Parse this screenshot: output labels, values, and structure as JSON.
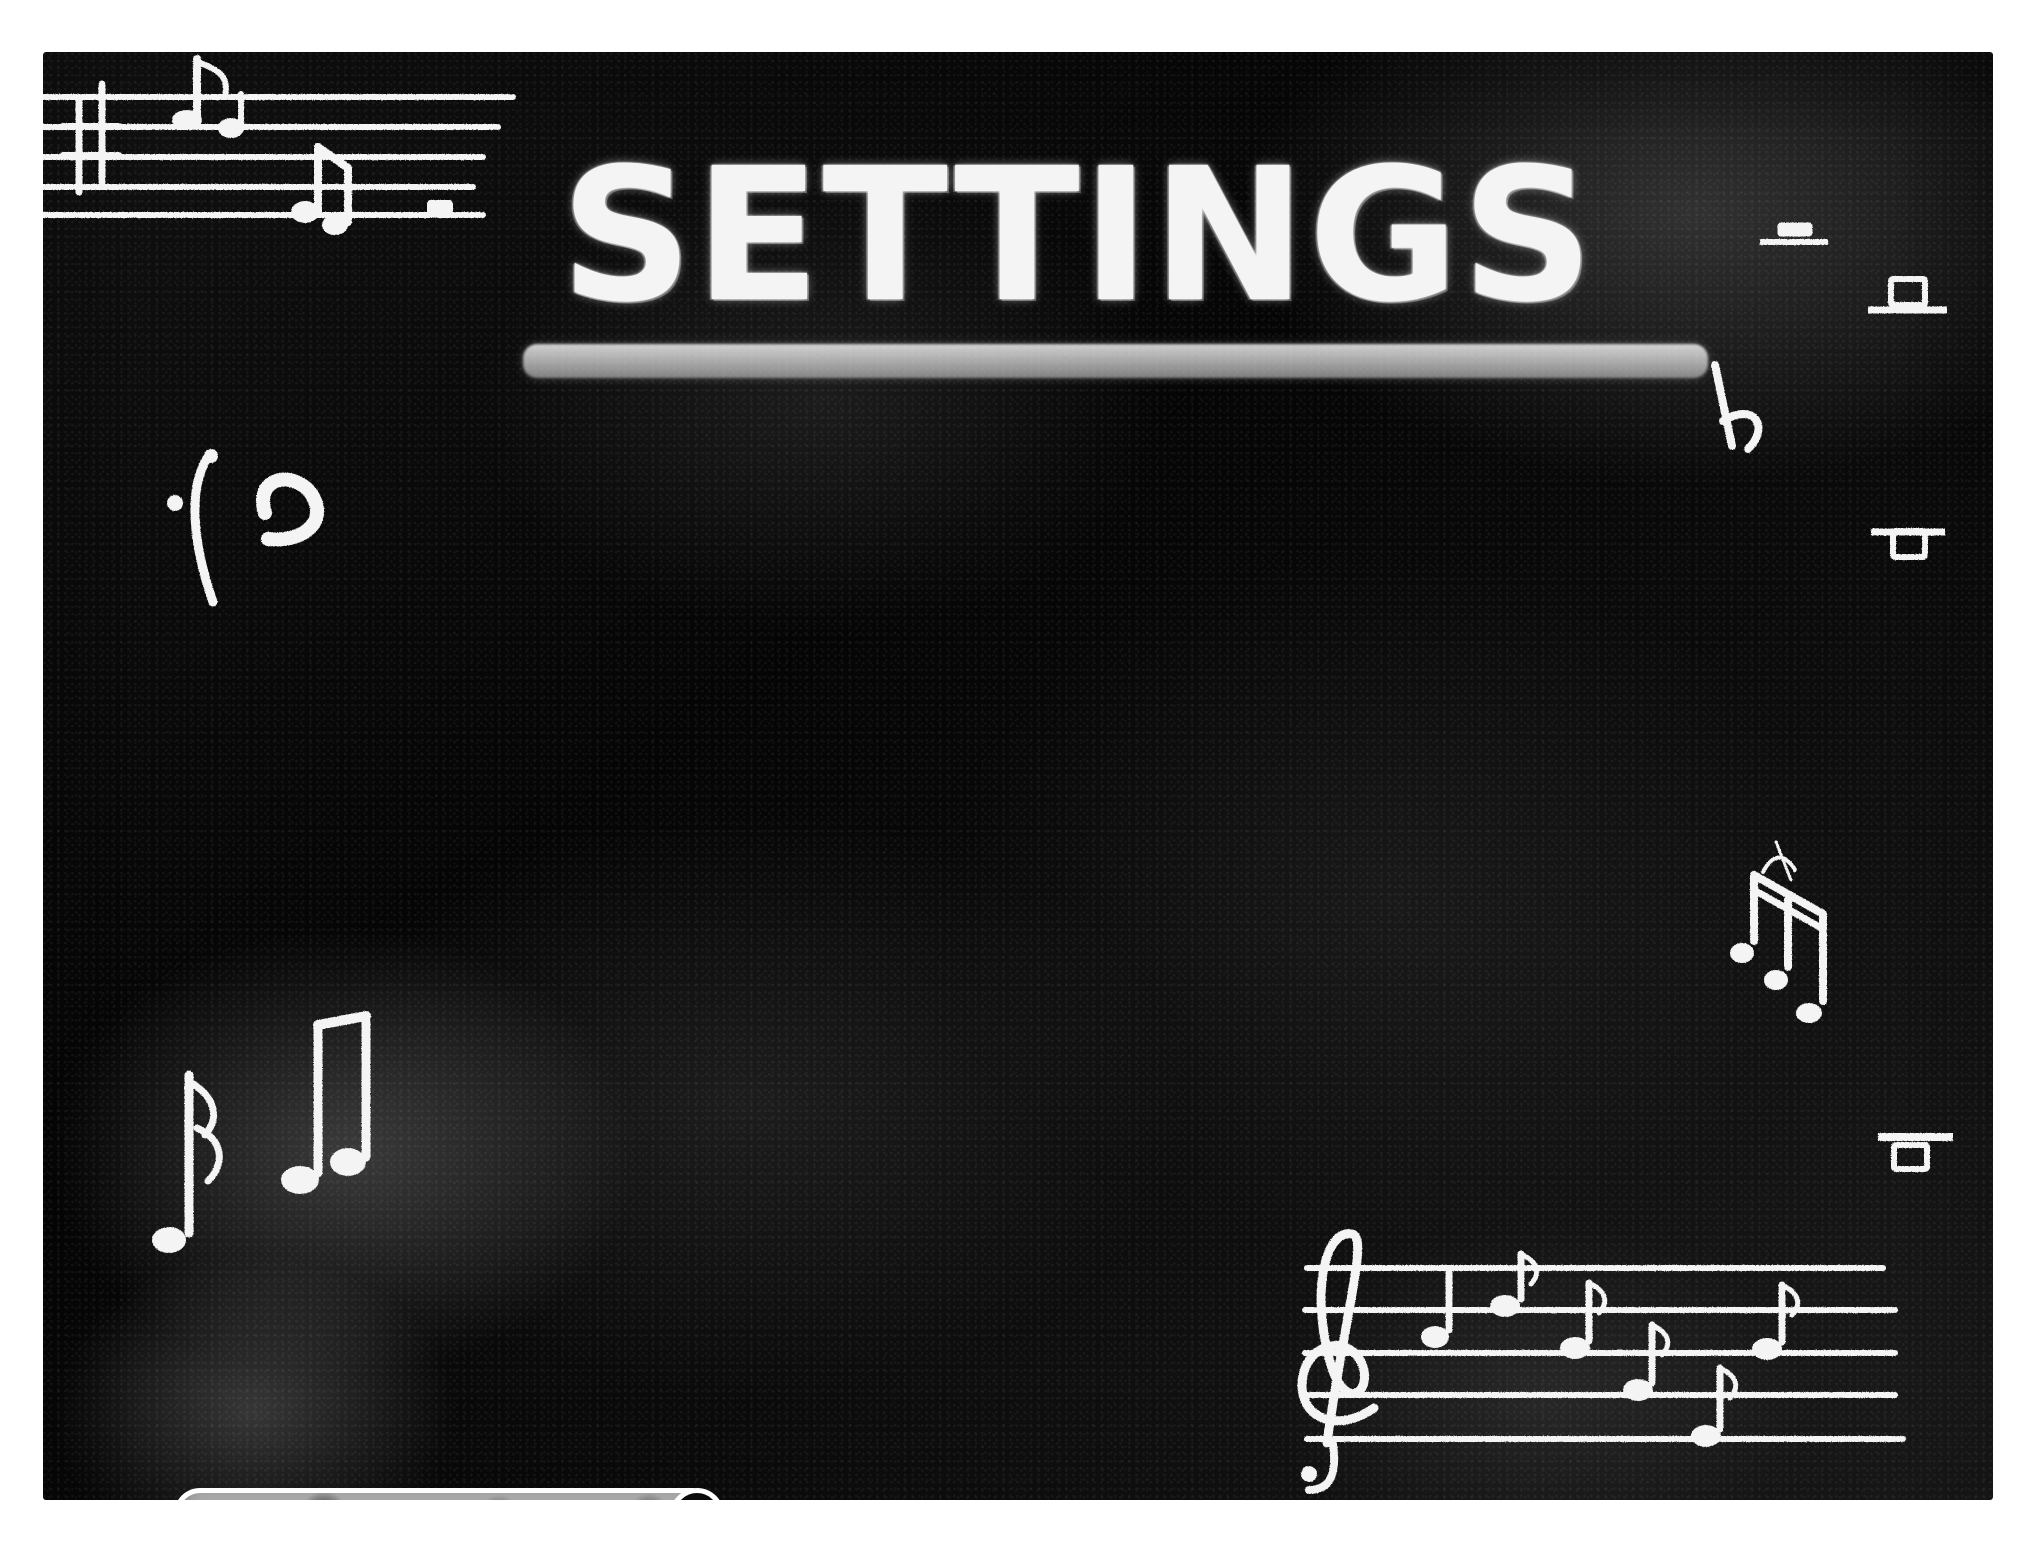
{
  "screen": {
    "title": "SETTINGS",
    "button": {
      "label": ""
    }
  },
  "decorations": {
    "icons": [
      "music-staff-icon",
      "bass-clef-icon",
      "flat-sign-icon",
      "music-note-icon",
      "treble-clef-icon",
      "rest-icon"
    ]
  },
  "colors": {
    "chalk": "#f5f5f5",
    "board": "#050505",
    "board_shadow": "#1f1f1f"
  }
}
